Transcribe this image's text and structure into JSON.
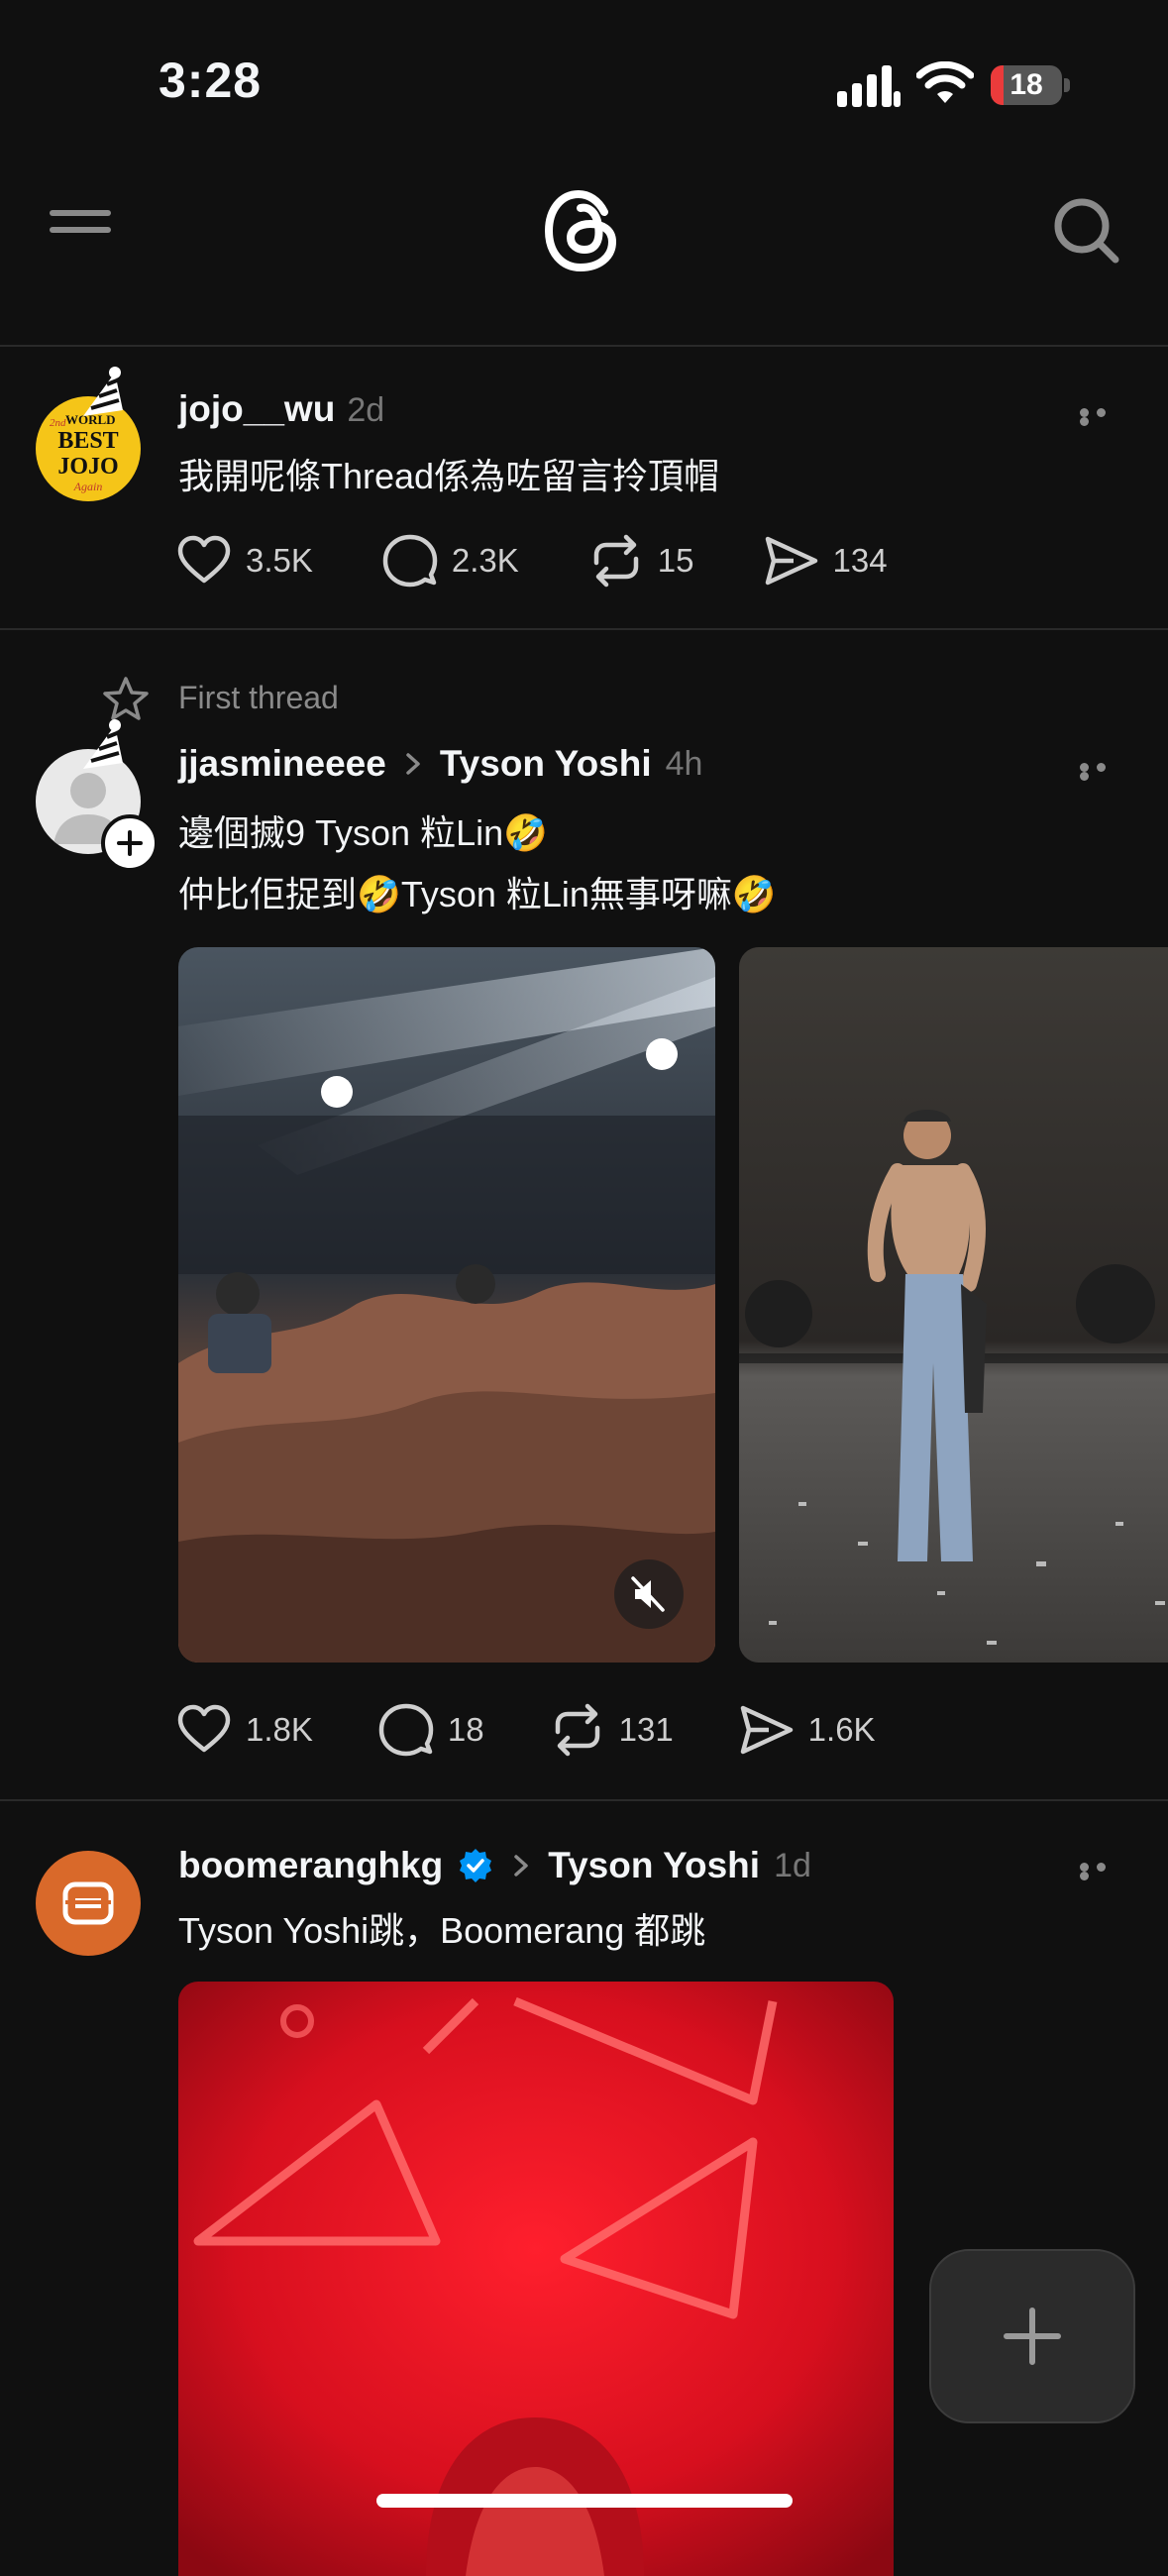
{
  "status_bar": {
    "time": "3:28",
    "battery_level": "18",
    "battery_fraction": 0.18,
    "icons": [
      "cellular-signal-icon",
      "wifi-icon",
      "battery-icon"
    ]
  },
  "header": {
    "icons": [
      "menu-icon",
      "threads-logo",
      "search-icon"
    ]
  },
  "posts": [
    {
      "username": "jojo__wu",
      "time": "2d",
      "avatar_text": [
        "2nd",
        "WORLD",
        "BEST",
        "JOJO",
        "Again"
      ],
      "text": "我開呢條Thread係為咗留言拎頂帽",
      "actions": {
        "likes": "3.5K",
        "replies": "2.3K",
        "reposts": "15",
        "shares": "134"
      }
    },
    {
      "label": "First thread",
      "username": "jjasmineeee",
      "reply_to": "Tyson Yoshi",
      "time": "4h",
      "text_lines": [
        "邊個搣9 Tyson 粒Lin🤣",
        "仲比佢捉到🤣Tyson 粒Lin無事呀嘛🤣"
      ],
      "actions": {
        "likes": "1.8K",
        "replies": "18",
        "reposts": "131",
        "shares": "1.6K"
      }
    },
    {
      "username": "boomeranghkg",
      "verified": true,
      "reply_to": "Tyson Yoshi",
      "time": "1d",
      "text": "Tyson Yoshi跳，Boomerang 都跳"
    }
  ],
  "colors": {
    "background": "#101010",
    "text": "#f3f5f7",
    "muted": "#777777",
    "verified": "#0095f6",
    "brand_orange": "#d9692a"
  }
}
